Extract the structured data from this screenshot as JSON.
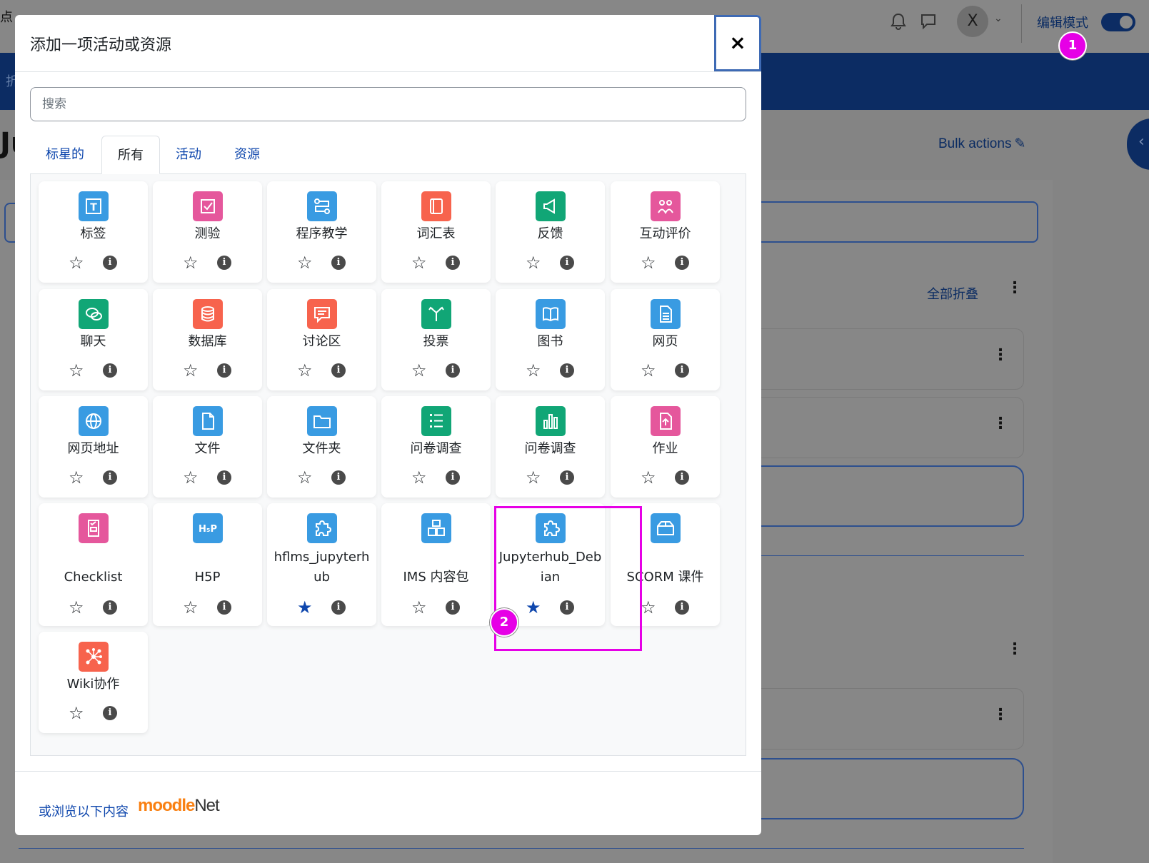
{
  "background": {
    "top_left_char": "点",
    "nav_left_char": "折",
    "heading_fragment": "Ju",
    "avatar_initial": "X",
    "edit_mode_label": "编辑模式",
    "bulk_actions": "Bulk actions",
    "collapse_all": "全部折叠"
  },
  "annotations": {
    "badge1": "1",
    "badge2": "2"
  },
  "modal": {
    "title": "添加一项活动或资源",
    "close": "×",
    "search_placeholder": "搜索",
    "tabs": [
      "标星的",
      "所有",
      "活动",
      "资源"
    ],
    "active_tab": "所有",
    "items": [
      {
        "label": "标签",
        "icon": "label-icon",
        "color": "#399be2",
        "starred": false
      },
      {
        "label": "测验",
        "icon": "quiz-icon",
        "color": "#e5579c",
        "starred": false
      },
      {
        "label": "程序教学",
        "icon": "lesson-icon",
        "color": "#399be2",
        "starred": false
      },
      {
        "label": "词汇表",
        "icon": "glossary-icon",
        "color": "#f7634d",
        "starred": false
      },
      {
        "label": "反馈",
        "icon": "feedback-icon",
        "color": "#11a676",
        "starred": false
      },
      {
        "label": "互动评价",
        "icon": "workshop-icon",
        "color": "#e5579c",
        "starred": false
      },
      {
        "label": "聊天",
        "icon": "chat-icon",
        "color": "#11a676",
        "starred": false
      },
      {
        "label": "数据库",
        "icon": "database-icon",
        "color": "#f7634d",
        "starred": false
      },
      {
        "label": "讨论区",
        "icon": "forum-icon",
        "color": "#f7634d",
        "starred": false
      },
      {
        "label": "投票",
        "icon": "choice-icon",
        "color": "#11a676",
        "starred": false
      },
      {
        "label": "图书",
        "icon": "book-icon",
        "color": "#399be2",
        "starred": false
      },
      {
        "label": "网页",
        "icon": "page-icon",
        "color": "#399be2",
        "starred": false
      },
      {
        "label": "网页地址",
        "icon": "url-icon",
        "color": "#399be2",
        "starred": false
      },
      {
        "label": "文件",
        "icon": "file-icon",
        "color": "#399be2",
        "starred": false
      },
      {
        "label": "文件夹",
        "icon": "folder-icon",
        "color": "#399be2",
        "starred": false
      },
      {
        "label": "问卷调查",
        "icon": "questionnaire-icon",
        "color": "#11a676",
        "starred": false
      },
      {
        "label": "问卷调查",
        "icon": "survey-chart-icon",
        "color": "#11a676",
        "starred": false
      },
      {
        "label": "作业",
        "icon": "assignment-icon",
        "color": "#e5579c",
        "starred": false
      },
      {
        "label": "Checklist",
        "icon": "checklist-icon",
        "color": "#e5579c",
        "starred": false
      },
      {
        "label": "H5P",
        "icon": "h5p-icon",
        "color": "#399be2",
        "starred": false
      },
      {
        "label": "hflms_jupyterhub",
        "icon": "puzzle-icon",
        "color": "#399be2",
        "starred": true
      },
      {
        "label": "IMS 内容包",
        "icon": "ims-icon",
        "color": "#399be2",
        "starred": false
      },
      {
        "label": "Jupyterhub_Debian",
        "icon": "puzzle-icon",
        "color": "#399be2",
        "starred": true
      },
      {
        "label": "SCORM 课件",
        "icon": "scorm-icon",
        "color": "#399be2",
        "starred": false
      },
      {
        "label": "Wiki协作",
        "icon": "wiki-icon",
        "color": "#f7634d",
        "starred": false
      }
    ],
    "footer_text": "或浏览以下内容",
    "moodlenet_brand": {
      "part1": "moodle",
      "part2": "Net"
    }
  }
}
